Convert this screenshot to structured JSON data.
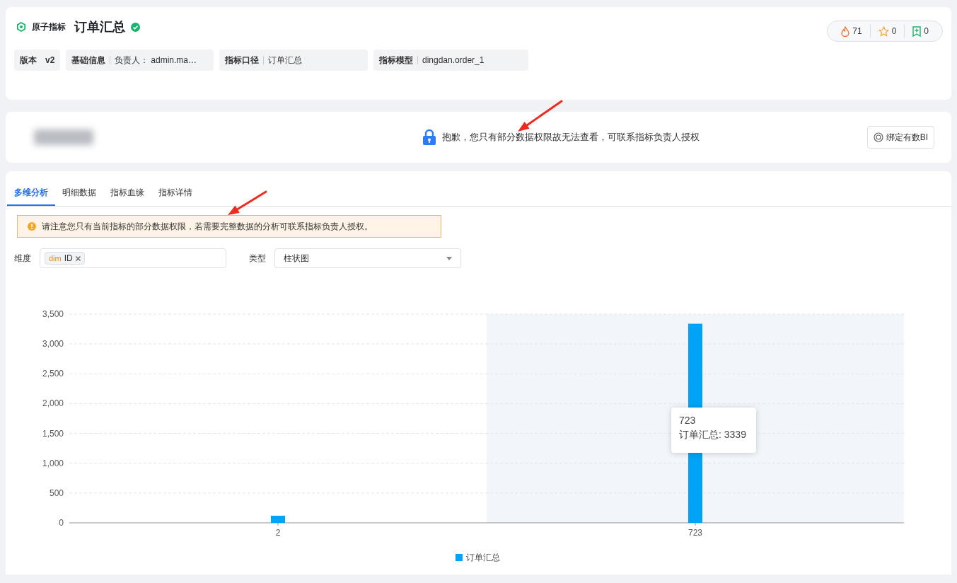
{
  "header": {
    "type_label": "原子指标",
    "title": "订单汇总",
    "verified": true,
    "stats": [
      {
        "kind": "heat",
        "count": "71"
      },
      {
        "kind": "star",
        "count": "0"
      },
      {
        "kind": "bookmark",
        "count": "0"
      }
    ],
    "info": [
      {
        "label": "版本",
        "value": "v2",
        "bold": true
      },
      {
        "label": "基础信息",
        "value": "负责人：  admin.ma…",
        "bold": false
      },
      {
        "label": "指标口径",
        "value": "订单汇总",
        "bold": false
      },
      {
        "label": "指标模型",
        "value": "dingdan.order_1",
        "bold": false
      }
    ]
  },
  "notice": {
    "message": "抱歉，您只有部分数据权限故无法查看，可联系指标负责人授权",
    "button": "绑定有数BI"
  },
  "tabs": [
    {
      "label": "多维分析",
      "selected": true
    },
    {
      "label": "明细数据",
      "selected": false
    },
    {
      "label": "指标血缘",
      "selected": false
    },
    {
      "label": "指标详情",
      "selected": false
    }
  ],
  "alert": "请注意您只有当前指标的部分数据权限，若需要完整数据的分析可联系指标负责人授权。",
  "filters": {
    "dimension_label": "维度",
    "tags": [
      {
        "prefix": "dim",
        "label": "ID"
      }
    ],
    "type_label": "类型",
    "type_value": "柱状图"
  },
  "chart_data": {
    "type": "bar",
    "categories": [
      "2",
      "723"
    ],
    "series": [
      {
        "name": "订单汇总",
        "color": "#00a3f5",
        "values": [
          120,
          3339
        ]
      }
    ],
    "ylim": [
      0,
      3500
    ],
    "yticks": [
      0,
      500,
      {
        "value": 1000,
        "label": "1,000"
      },
      {
        "value": 1500,
        "label": "1,500"
      },
      {
        "value": 2000,
        "label": "2,000"
      },
      {
        "value": 2500,
        "label": "2,500"
      },
      {
        "value": 3000,
        "label": "3,000"
      },
      {
        "value": 3500,
        "label": "3,500"
      }
    ],
    "grid": true
  },
  "tooltip": {
    "title": "723",
    "text": "订单汇总: 3339"
  },
  "annotations": [
    {
      "kind": "arrow"
    },
    {
      "kind": "arrow"
    }
  ]
}
